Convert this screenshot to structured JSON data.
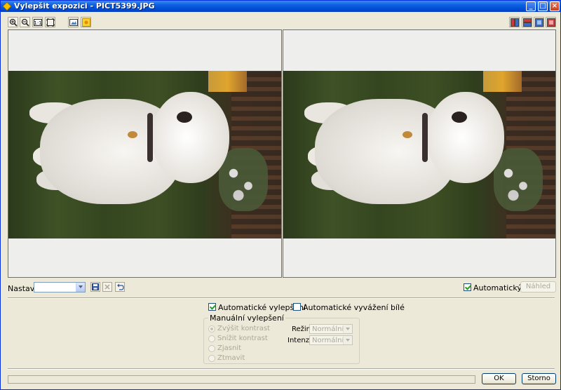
{
  "window": {
    "title": "Vylepšit expozici - PICT5399.JPG"
  },
  "title_buttons": {
    "minimize": "_",
    "maximize": "□",
    "close": "×"
  },
  "toolbar_left": [
    {
      "name": "zoom-in-icon"
    },
    {
      "name": "zoom-out-icon"
    },
    {
      "name": "actual-size-icon",
      "text": "1:1"
    },
    {
      "name": "fit-window-icon"
    },
    {
      "name": "image-icon"
    },
    {
      "name": "highlight-icon"
    }
  ],
  "toolbar_right": [
    {
      "name": "split-vertical-icon"
    },
    {
      "name": "split-horizontal-icon"
    },
    {
      "name": "single-before-icon"
    },
    {
      "name": "single-after-icon"
    }
  ],
  "settings": {
    "label": "Nastavení:",
    "value": ""
  },
  "auto_preview": {
    "label": "Automatický náhled",
    "checked": true
  },
  "preview_button": "Náhled",
  "auto_enhance": {
    "label": "Automatické vylepšení",
    "checked": true
  },
  "auto_white_balance": {
    "label": "Automatické vyvážení bílé",
    "checked": false
  },
  "manual": {
    "title": "Manuální vylepšení",
    "options": [
      {
        "label": "Zvýšit kontrast",
        "checked": true
      },
      {
        "label": "Snížit kontrast",
        "checked": false
      },
      {
        "label": "Zjasnit",
        "checked": false
      },
      {
        "label": "Ztmavit",
        "checked": false
      }
    ],
    "mode_label": "Režim:",
    "mode_value": "Normální",
    "intensity_label": "Intenzita:",
    "intensity_value": "Normální"
  },
  "ok_button": "OK",
  "cancel_button": "Storno",
  "progress": {
    "fraction": 0.0
  },
  "colors": {
    "title_bar": "#0a5fe0",
    "face": "#ece9d8",
    "progress": "#3d95ff"
  }
}
